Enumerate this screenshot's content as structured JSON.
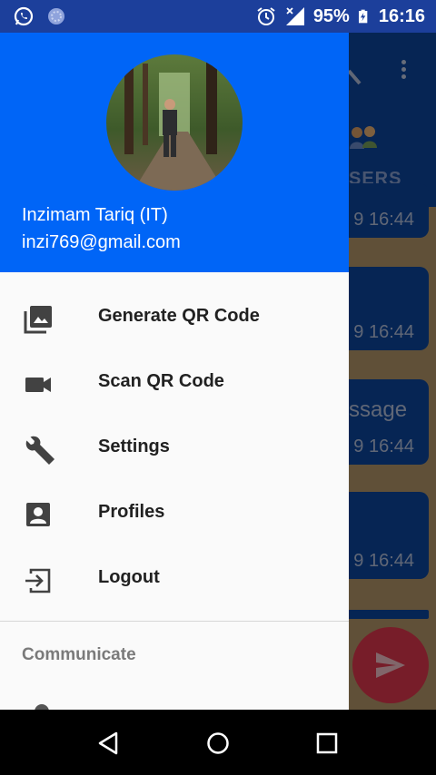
{
  "status_bar": {
    "battery": "95%",
    "time": "16:16",
    "icons": [
      "whatsapp-icon",
      "sync-icon",
      "alarm-icon",
      "signal-off-icon",
      "battery-charging-icon"
    ]
  },
  "background_app": {
    "tab_label": "SERS",
    "messages": [
      {
        "text": "",
        "time": "9 16:44"
      },
      {
        "text": "",
        "time": "9 16:44"
      },
      {
        "text": "ssage",
        "time": "9 16:44"
      },
      {
        "text": "",
        "time": "9 16:44"
      }
    ],
    "send_button_icon": "send-icon",
    "fab_color": "#e53950"
  },
  "drawer": {
    "header_color": "#0065f7",
    "user": {
      "name": "Inzimam Tariq (IT)",
      "email": "inzi769@gmail.com"
    },
    "menu": [
      {
        "label": "Generate QR Code",
        "icon": "photo-library-icon"
      },
      {
        "label": "Scan QR Code",
        "icon": "videocam-icon"
      },
      {
        "label": "Settings",
        "icon": "wrench-icon"
      },
      {
        "label": "Profiles",
        "icon": "account-box-icon"
      },
      {
        "label": "Logout",
        "icon": "exit-icon"
      }
    ],
    "section": "Communicate"
  },
  "nav_bar": {
    "buttons": [
      "back-icon",
      "home-icon",
      "recents-icon"
    ]
  }
}
